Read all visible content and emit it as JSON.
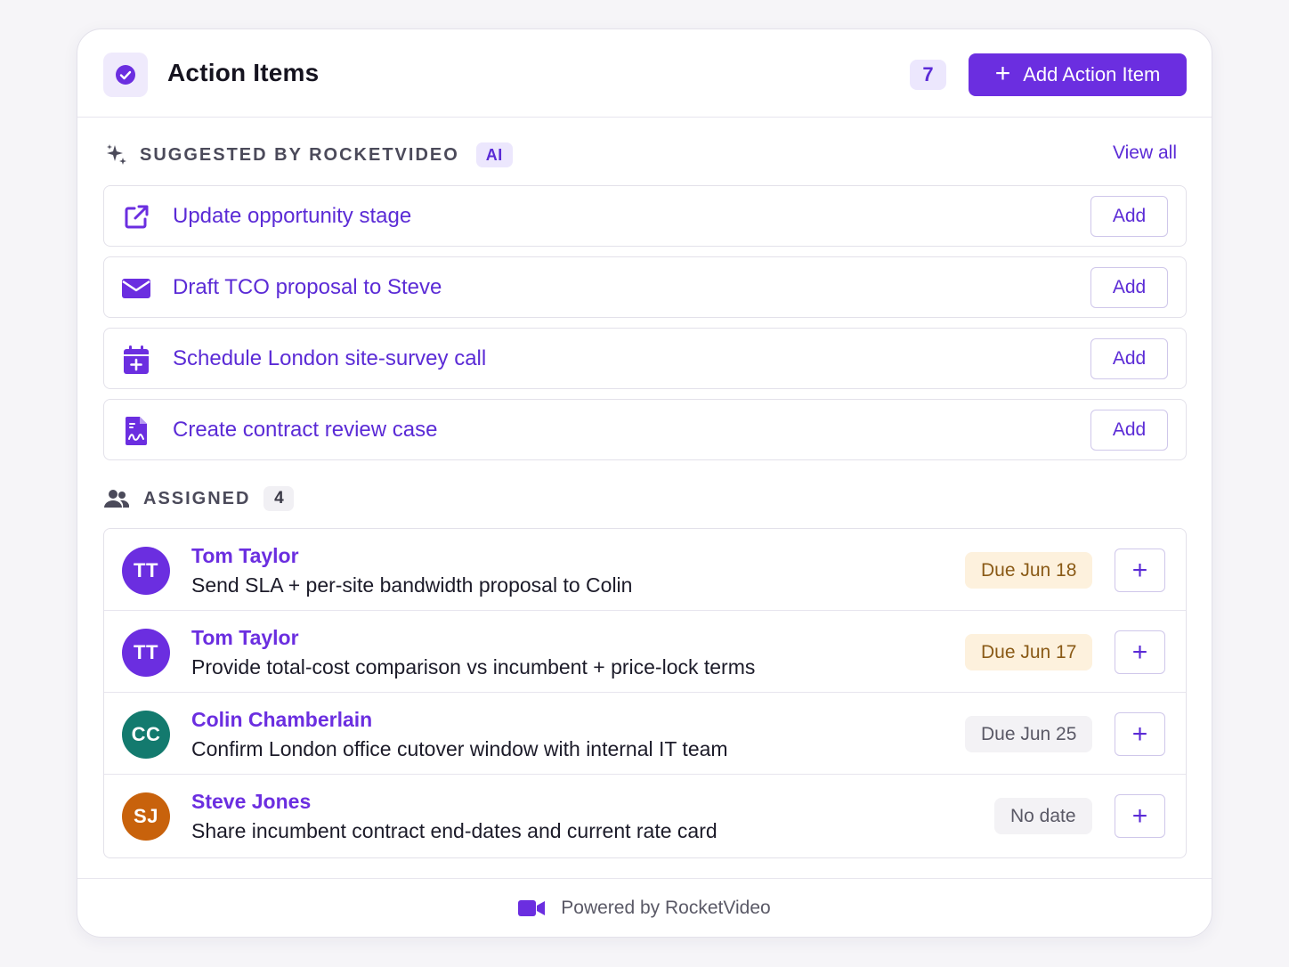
{
  "header": {
    "title": "Action Items",
    "count": "7",
    "add_button_label": "Add Action Item",
    "icon": "check-circle-icon"
  },
  "suggested": {
    "label": "SUGGESTED BY ROCKETVIDEO",
    "ai_badge": "AI",
    "view_all": "View all",
    "icon": "sparkles-icon",
    "items": [
      {
        "label": "Update opportunity stage",
        "icon": "external-link-icon",
        "button": "Add"
      },
      {
        "label": "Draft TCO proposal to Steve",
        "icon": "envelope-icon",
        "button": "Add"
      },
      {
        "label": "Schedule London site-survey call",
        "icon": "calendar-plus-icon",
        "button": "Add"
      },
      {
        "label": "Create contract review case",
        "icon": "document-signature-icon",
        "button": "Add"
      }
    ]
  },
  "assigned": {
    "label": "ASSIGNED",
    "count": "4",
    "icon": "users-icon",
    "items": [
      {
        "initials": "TT",
        "name": "Tom Taylor",
        "task": "Send SLA + per-site bandwidth proposal to Colin",
        "due": "Due Jun 18",
        "due_style": "warn",
        "avatar_color": "#6b2ee0"
      },
      {
        "initials": "TT",
        "name": "Tom Taylor",
        "task": "Provide total-cost comparison vs incumbent + price-lock terms",
        "due": "Due Jun 17",
        "due_style": "warn",
        "avatar_color": "#6b2ee0"
      },
      {
        "initials": "CC",
        "name": "Colin Chamberlain",
        "task": "Confirm London office cutover window with internal IT team",
        "due": "Due Jun 25",
        "due_style": "neutral",
        "avatar_color": "#137a6e"
      },
      {
        "initials": "SJ",
        "name": "Steve Jones",
        "task": "Share incumbent contract end-dates and current rate card",
        "due": "No date",
        "due_style": "neutral",
        "avatar_color": "#c8620c"
      }
    ]
  },
  "footer": {
    "text": "Powered by RocketVideo",
    "icon": "video-camera-icon"
  },
  "colors": {
    "accent": "#6b2ee0",
    "accent_text": "#5b2bd6",
    "warn_bg": "#fdf1dd",
    "warn_text": "#8a5a16"
  }
}
